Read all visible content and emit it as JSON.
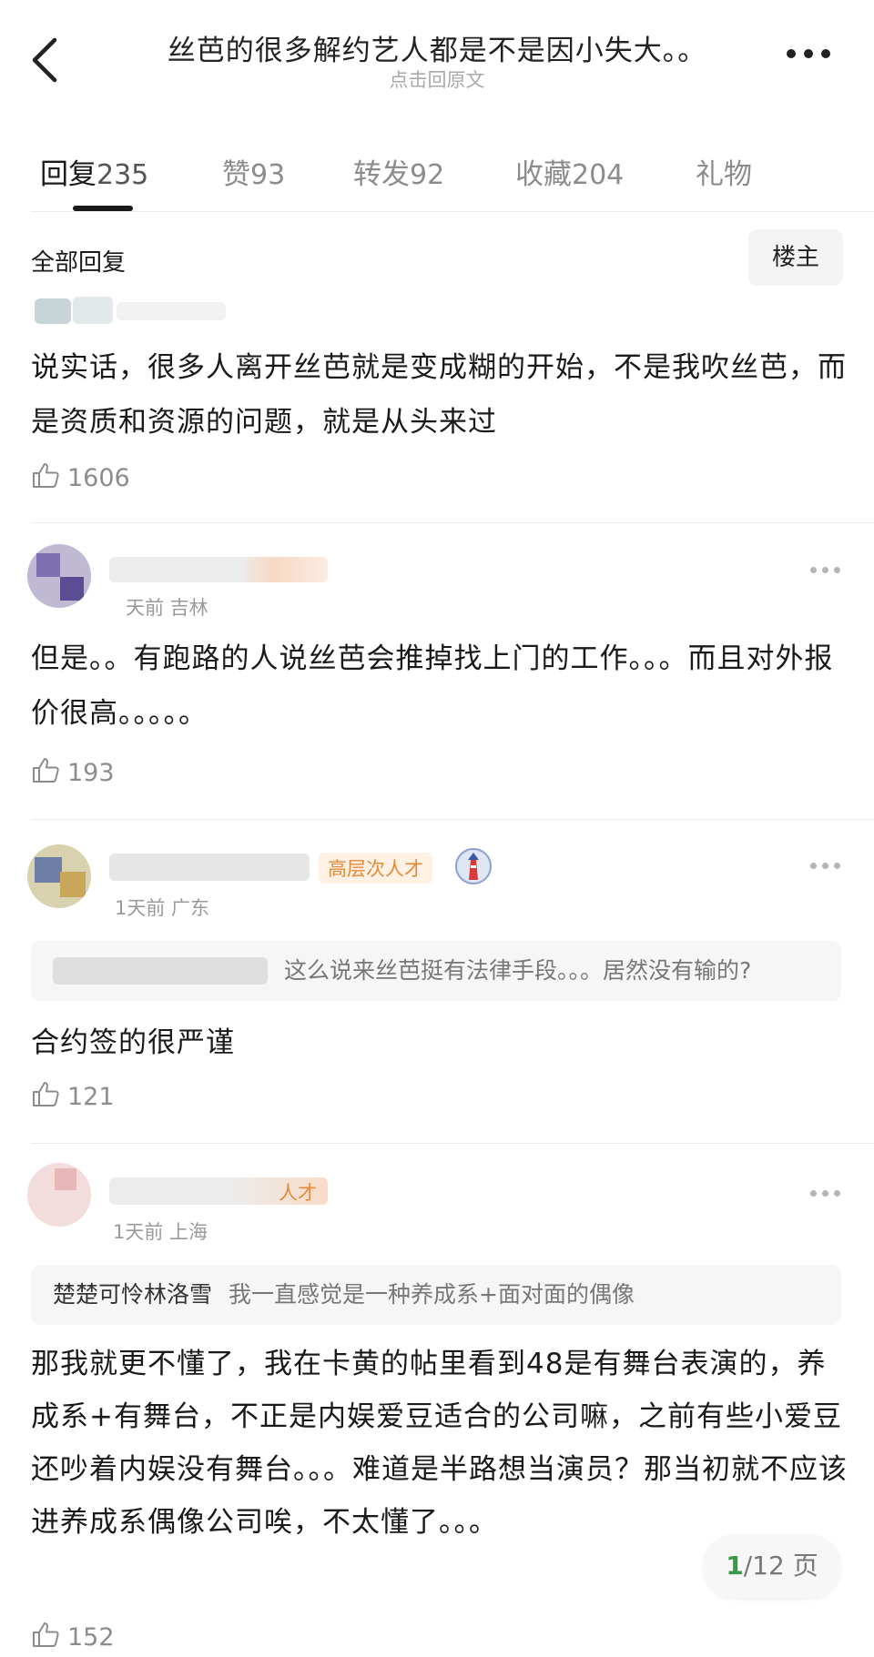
{
  "header": {
    "title": "丝芭的很多解约艺人都是不是因小失大。。",
    "subtitle": "点击回原文"
  },
  "tabs": [
    {
      "label": "回复",
      "count": "235"
    },
    {
      "label": "赞",
      "count": "93"
    },
    {
      "label": "转发",
      "count": "92"
    },
    {
      "label": "收藏",
      "count": "204"
    },
    {
      "label": "礼物",
      "count": ""
    }
  ],
  "filter": {
    "all_label": "全部回复",
    "op_label": "楼主"
  },
  "comments": [
    {
      "meta": "",
      "badge": "",
      "quote_name": "",
      "quote_text": "",
      "text": "说实话，很多人离开丝芭就是变成糊的开始，不是我吹丝芭，而是资质和资源的问题，就是从头来过",
      "likes": "1606"
    },
    {
      "meta": "天前 吉林",
      "badge": "",
      "quote_name": "",
      "quote_text": "",
      "text": "但是。。有跑路的人说丝芭会推掉找上门的工作。。。而且对外报价很高。。。。。",
      "likes": "193"
    },
    {
      "meta": "1天前 广东",
      "badge": "高层次人才",
      "quote_name": "",
      "quote_text": "这么说来丝芭挺有法律手段。。。居然没有输的?",
      "text": "合约签的很严谨",
      "likes": "121"
    },
    {
      "meta": "1天前 上海",
      "badge": "人才",
      "quote_name": "楚楚可怜林洛雪",
      "quote_text": "我一直感觉是一种养成系+面对面的偶像",
      "text": "那我就更不懂了，我在卡黄的帖里看到48是有舞台表演的，养成系+有舞台，不正是内娱爱豆适合的公司嘛，之前有些小爱豆还吵着内娱没有舞台。。。难道是半路想当演员？那当初就不应该进养成系偶像公司唉，不太懂了。。。",
      "likes": "152"
    }
  ],
  "pager": {
    "current": "1",
    "rest": "/12 页"
  }
}
